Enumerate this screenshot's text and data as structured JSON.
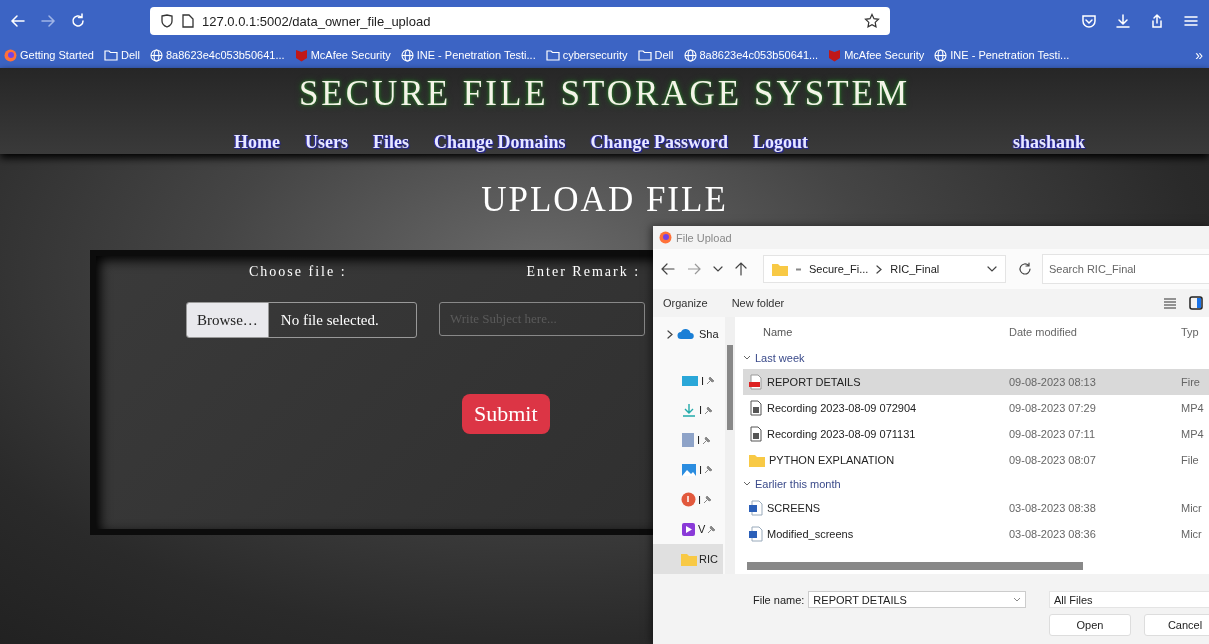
{
  "browser": {
    "url": "127.0.0.1:5002/data_owner_file_upload",
    "bookmarks": [
      {
        "label": "Getting Started",
        "kind": "firefox"
      },
      {
        "label": "Dell",
        "kind": "folder"
      },
      {
        "label": "8a8623e4c053b50641...",
        "kind": "globe"
      },
      {
        "label": "McAfee Security",
        "kind": "mcafee"
      },
      {
        "label": "INE - Penetration Testi...",
        "kind": "globe"
      },
      {
        "label": "cybersecurity",
        "kind": "folder"
      },
      {
        "label": "Dell",
        "kind": "folder"
      },
      {
        "label": "8a8623e4c053b50641...",
        "kind": "globe"
      },
      {
        "label": "McAfee Security",
        "kind": "mcafee"
      },
      {
        "label": "INE - Penetration Testi...",
        "kind": "globe"
      }
    ],
    "overflow": "»"
  },
  "site": {
    "title": "SECURE FILE STORAGE SYSTEM",
    "nav": [
      "Home",
      "Users",
      "Files",
      "Change Domains",
      "Change Password",
      "Logout"
    ],
    "user": "shashank",
    "heading": "UPLOAD FILE",
    "form": {
      "file_label": "Choose file :",
      "browse": "Browse…",
      "file_status": "No file selected.",
      "remark_label": "Enter Remark :",
      "remark_placeholder": "Write Subject here...",
      "submit": "Submit"
    }
  },
  "dialog": {
    "title": "File Upload",
    "path": [
      "Secure_Fi...",
      "RIC_Final"
    ],
    "search_placeholder": "Search RIC_Final",
    "organize": "Organize",
    "new_folder": "New folder",
    "sidebar": [
      {
        "label": "Sha",
        "kind": "cloud"
      },
      {
        "label": "I",
        "kind": "desktop"
      },
      {
        "label": "I",
        "kind": "download"
      },
      {
        "label": "I",
        "kind": "document"
      },
      {
        "label": "I",
        "kind": "pictures"
      },
      {
        "label": "I",
        "kind": "music"
      },
      {
        "label": "V",
        "kind": "videos"
      },
      {
        "label": "RIC",
        "kind": "folder"
      }
    ],
    "columns": [
      "Name",
      "Date modified",
      "Typ"
    ],
    "groups": [
      {
        "label": "Last week",
        "files": [
          {
            "name": "REPORT DETAILS",
            "date": "09-08-2023 08:13",
            "type": "Fire",
            "kind": "pdf",
            "selected": true
          },
          {
            "name": "Recording 2023-08-09 072904",
            "date": "09-08-2023 07:29",
            "type": "MP4",
            "kind": "video",
            "selected": false
          },
          {
            "name": "Recording 2023-08-09 071131",
            "date": "09-08-2023 07:11",
            "type": "MP4",
            "kind": "video",
            "selected": false
          },
          {
            "name": "PYTHON EXPLANATION",
            "date": "09-08-2023 08:07",
            "type": "File",
            "kind": "folder",
            "selected": false
          }
        ]
      },
      {
        "label": "Earlier this month",
        "files": [
          {
            "name": "SCREENS",
            "date": "03-08-2023 08:38",
            "type": "Micr",
            "kind": "word",
            "selected": false
          },
          {
            "name": "Modified_screens",
            "date": "03-08-2023 08:36",
            "type": "Micr",
            "kind": "word",
            "selected": false
          }
        ]
      }
    ],
    "file_name_label": "File name:",
    "file_name": "REPORT DETAILS",
    "filter": "All Files",
    "buttons": [
      "Open",
      "Cancel"
    ]
  }
}
